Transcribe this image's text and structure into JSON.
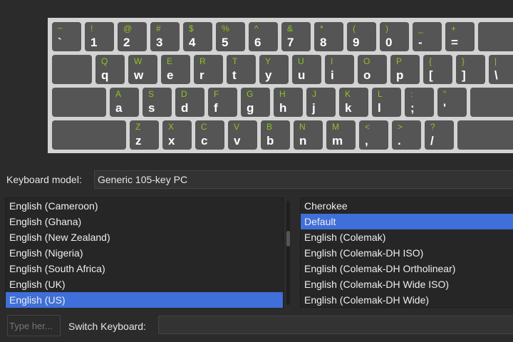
{
  "keyboard_rows": [
    [
      [
        "~",
        "`"
      ],
      [
        "!",
        "1"
      ],
      [
        "@",
        "2"
      ],
      [
        "#",
        "3"
      ],
      [
        "$",
        "4"
      ],
      [
        "%",
        "5"
      ],
      [
        "^",
        "6"
      ],
      [
        "&",
        "7"
      ],
      [
        "*",
        "8"
      ],
      [
        "(",
        "9"
      ],
      [
        ")",
        "0"
      ],
      [
        "_",
        "-"
      ],
      [
        "+",
        "="
      ]
    ],
    [
      [
        "Q",
        "q"
      ],
      [
        "W",
        "w"
      ],
      [
        "E",
        "e"
      ],
      [
        "R",
        "r"
      ],
      [
        "T",
        "t"
      ],
      [
        "Y",
        "y"
      ],
      [
        "U",
        "u"
      ],
      [
        "I",
        "i"
      ],
      [
        "O",
        "o"
      ],
      [
        "P",
        "p"
      ],
      [
        "{",
        "["
      ],
      [
        "}",
        "]"
      ],
      [
        "|",
        "\\"
      ]
    ],
    [
      [
        "A",
        "a"
      ],
      [
        "S",
        "s"
      ],
      [
        "D",
        "d"
      ],
      [
        "F",
        "f"
      ],
      [
        "G",
        "g"
      ],
      [
        "H",
        "h"
      ],
      [
        "J",
        "j"
      ],
      [
        "K",
        "k"
      ],
      [
        "L",
        "l"
      ],
      [
        ":",
        ";"
      ],
      [
        "\"",
        "'"
      ]
    ],
    [
      [
        "Z",
        "z"
      ],
      [
        "X",
        "x"
      ],
      [
        "C",
        "c"
      ],
      [
        "V",
        "v"
      ],
      [
        "B",
        "b"
      ],
      [
        "N",
        "n"
      ],
      [
        "M",
        "m"
      ],
      [
        "<",
        ","
      ],
      [
        ">",
        "."
      ],
      [
        "?",
        "/"
      ]
    ]
  ],
  "colors": {
    "shift_label": "#8fc31f",
    "selection": "#3f6fd8"
  },
  "model": {
    "label": "Keyboard model:",
    "value": "Generic 105-key PC"
  },
  "layouts": {
    "items": [
      "English (Cameroon)",
      "English (Ghana)",
      "English (New Zealand)",
      "English (Nigeria)",
      "English (South Africa)",
      "English (UK)",
      "English (US)"
    ],
    "selected": 6
  },
  "variants": {
    "items": [
      "Cherokee",
      "Default",
      "English (Colemak)",
      "English (Colemak-DH ISO)",
      "English (Colemak-DH Ortholinear)",
      "English (Colemak-DH Wide ISO)",
      "English (Colemak-DH Wide)"
    ],
    "selected": 1
  },
  "test_input": {
    "placeholder": "Type her..."
  },
  "switch": {
    "label": "Switch Keyboard:",
    "value": ""
  }
}
